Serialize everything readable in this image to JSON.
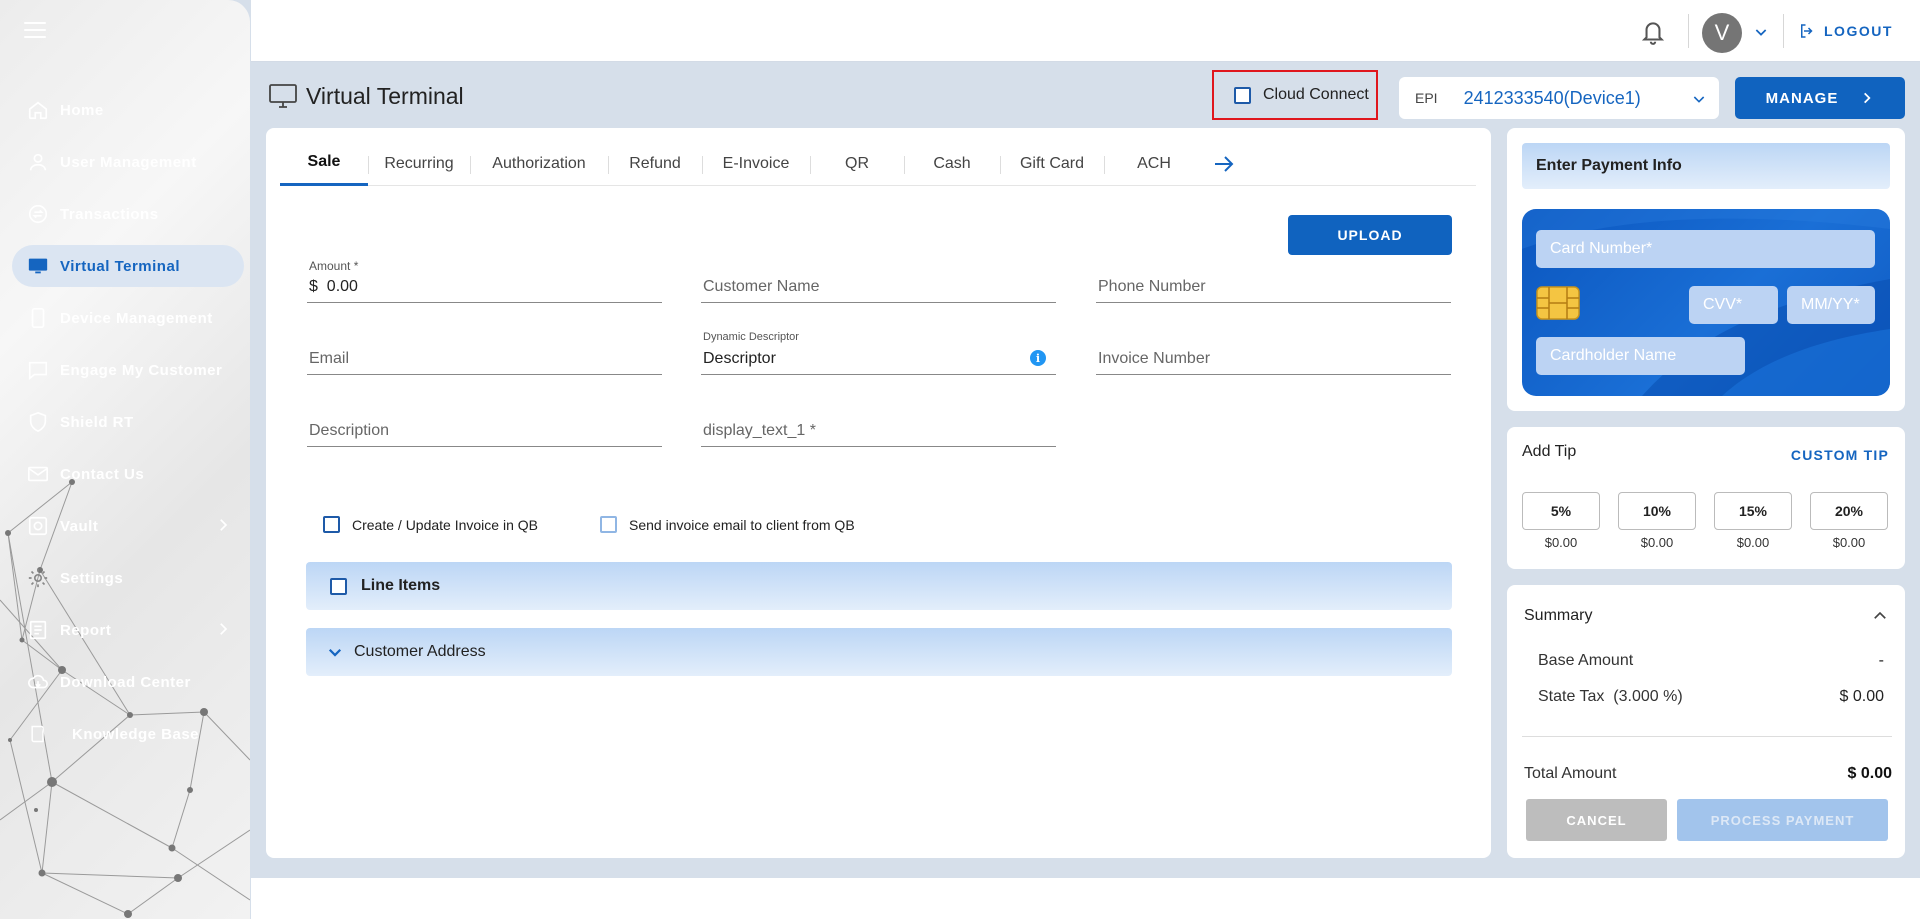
{
  "sidebar": {
    "items": [
      {
        "label": "Home",
        "icon": "home-icon"
      },
      {
        "label": "User Management",
        "icon": "user-icon"
      },
      {
        "label": "Transactions",
        "icon": "transactions-icon"
      },
      {
        "label": "Virtual Terminal",
        "icon": "monitor-icon",
        "active": true
      },
      {
        "label": "Device Management",
        "icon": "device-icon"
      },
      {
        "label": "Engage My Customer",
        "icon": "chat-icon"
      },
      {
        "label": "Shield RT",
        "icon": "shield-icon"
      },
      {
        "label": "Contact Us",
        "icon": "mail-icon"
      },
      {
        "label": "Vault",
        "icon": "vault-icon",
        "has_submenu": true
      },
      {
        "label": "Settings",
        "icon": "gear-icon"
      },
      {
        "label": "Report",
        "icon": "report-icon",
        "has_submenu": true
      },
      {
        "label": "Download Center",
        "icon": "cloud-download-icon"
      },
      {
        "label": "Knowledge Base",
        "icon": "book-icon"
      }
    ]
  },
  "topbar": {
    "avatar_initial": "V",
    "logout_label": "LOGOUT"
  },
  "header": {
    "title": "Virtual Terminal",
    "cloud_connect_label": "Cloud Connect",
    "cloud_connect_checked": false,
    "epi_label": "EPI",
    "epi_value": "2412333540(Device1)",
    "manage_label": "MANAGE"
  },
  "tabs": [
    {
      "label": "Sale",
      "active": true
    },
    {
      "label": "Recurring"
    },
    {
      "label": "Authorization"
    },
    {
      "label": "Refund"
    },
    {
      "label": "E-Invoice"
    },
    {
      "label": "QR"
    },
    {
      "label": "Cash"
    },
    {
      "label": "Gift Card"
    },
    {
      "label": "ACH"
    }
  ],
  "form": {
    "upload_label": "UPLOAD",
    "amount_label": "Amount *",
    "currency_symbol": "$",
    "amount_value": "0.00",
    "customer_name_placeholder": "Customer Name",
    "phone_placeholder": "Phone Number",
    "email_placeholder": "Email",
    "descriptor_label": "Dynamic Descriptor",
    "descriptor_value": "Descriptor",
    "invoice_placeholder": "Invoice Number",
    "description_placeholder": "Description",
    "display_text_placeholder": "display_text_1 *",
    "qb_create_label": "Create / Update Invoice in QB",
    "qb_send_label": "Send invoice email to client from QB",
    "line_items_label": "Line Items",
    "customer_address_label": "Customer Address"
  },
  "payment": {
    "title": "Enter Payment Info",
    "card_number_placeholder": "Card Number*",
    "cvv_placeholder": "CVV*",
    "expiry_placeholder": "MM/YY*",
    "cardholder_placeholder": "Cardholder Name"
  },
  "tip": {
    "title": "Add Tip",
    "custom_label": "CUSTOM TIP",
    "options": [
      {
        "percent": "5%",
        "amount": "$0.00"
      },
      {
        "percent": "10%",
        "amount": "$0.00"
      },
      {
        "percent": "15%",
        "amount": "$0.00"
      },
      {
        "percent": "20%",
        "amount": "$0.00"
      }
    ]
  },
  "summary": {
    "title": "Summary",
    "base_amount_label": "Base Amount",
    "base_amount_value": "-",
    "state_tax_label": "State Tax  (3.000 %)",
    "state_tax_value": "$ 0.00",
    "total_label": "Total Amount",
    "total_value": "$ 0.00",
    "cancel_label": "CANCEL",
    "process_label": "PROCESS PAYMENT"
  },
  "colors": {
    "primary": "#1063bf",
    "link": "#1565c0",
    "highlight_border": "#e0161d",
    "page_bg": "#d6dfea"
  }
}
